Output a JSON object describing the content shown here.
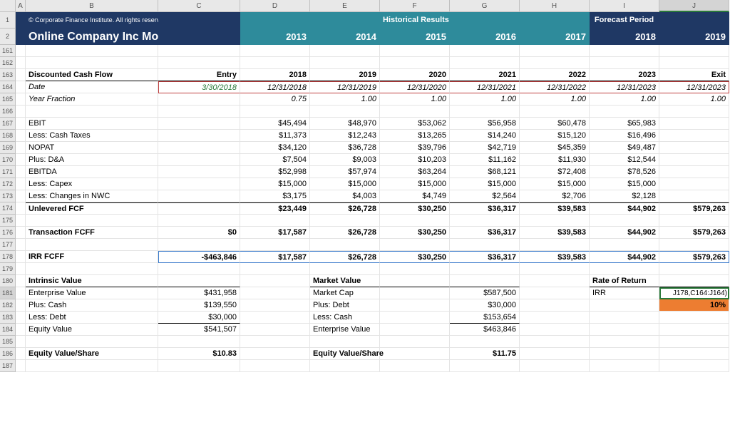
{
  "cols": [
    "A",
    "B",
    "C",
    "D",
    "E",
    "F",
    "G",
    "H",
    "I",
    "J"
  ],
  "rowNumbers": [
    "1",
    "2",
    "161",
    "162",
    "163",
    "164",
    "165",
    "166",
    "167",
    "168",
    "169",
    "170",
    "171",
    "172",
    "173",
    "174",
    "175",
    "176",
    "177",
    "178",
    "179",
    "180",
    "181",
    "182",
    "183",
    "184",
    "185",
    "186",
    "187"
  ],
  "header": {
    "copyright": "© Corporate Finance Institute. All rights reserved.",
    "historical": "Historical Results",
    "forecast": "Forecast Period",
    "title": "Online Company Inc Model",
    "years": [
      "2013",
      "2014",
      "2015",
      "2016",
      "2017",
      "2018",
      "2019"
    ]
  },
  "dcf": {
    "heading": "Discounted Cash Flow",
    "entry": "Entry",
    "periods": [
      "2018",
      "2019",
      "2020",
      "2021",
      "2022",
      "2023"
    ],
    "exit": "Exit",
    "dateLabel": "Date",
    "dateEntry": "3/30/2018",
    "dates": [
      "12/31/2018",
      "12/31/2019",
      "12/31/2020",
      "12/31/2021",
      "12/31/2022",
      "12/31/2023",
      "12/31/2023"
    ],
    "yfLabel": "Year Fraction",
    "yf": [
      "0.75",
      "1.00",
      "1.00",
      "1.00",
      "1.00",
      "1.00",
      "1.00"
    ],
    "rows": [
      {
        "label": "EBIT",
        "v": [
          "$45,494",
          "$48,970",
          "$53,062",
          "$56,958",
          "$60,478",
          "$65,983",
          ""
        ]
      },
      {
        "label": "Less: Cash Taxes",
        "v": [
          "$11,373",
          "$12,243",
          "$13,265",
          "$14,240",
          "$15,120",
          "$16,496",
          ""
        ],
        "ul": true
      },
      {
        "label": "NOPAT",
        "v": [
          "$34,120",
          "$36,728",
          "$39,796",
          "$42,719",
          "$45,359",
          "$49,487",
          ""
        ]
      },
      {
        "label": "Plus: D&A",
        "v": [
          "$7,504",
          "$9,003",
          "$10,203",
          "$11,162",
          "$11,930",
          "$12,544",
          ""
        ],
        "ul": true
      },
      {
        "label": "EBITDA",
        "v": [
          "$52,998",
          "$57,974",
          "$63,264",
          "$68,121",
          "$72,408",
          "$78,526",
          ""
        ]
      },
      {
        "label": "Less: Capex",
        "v": [
          "$15,000",
          "$15,000",
          "$15,000",
          "$15,000",
          "$15,000",
          "$15,000",
          ""
        ]
      },
      {
        "label": "Less: Changes in NWC",
        "v": [
          "$3,175",
          "$4,003",
          "$4,749",
          "$2,564",
          "$2,706",
          "$2,128",
          ""
        ],
        "ul": true
      }
    ],
    "ufcf": {
      "label": "Unlevered FCF",
      "v": [
        "$23,449",
        "$26,728",
        "$30,250",
        "$36,317",
        "$39,583",
        "$44,902",
        "$579,263"
      ]
    },
    "tfcff": {
      "label": "Transaction FCFF",
      "entry": "$0",
      "v": [
        "$17,587",
        "$26,728",
        "$30,250",
        "$36,317",
        "$39,583",
        "$44,902",
        "$579,263"
      ]
    },
    "irr": {
      "label": "IRR FCFF",
      "entry": "-$463,846",
      "v": [
        "$17,587",
        "$26,728",
        "$30,250",
        "$36,317",
        "$39,583",
        "$44,902",
        "$579,263"
      ]
    }
  },
  "intrinsic": {
    "heading": "Intrinsic Value",
    "rows": [
      {
        "label": "Enterprise Value",
        "val": "$431,958"
      },
      {
        "label": "Plus: Cash",
        "val": "$139,550"
      },
      {
        "label": "Less: Debt",
        "val": "$30,000",
        "ul": true
      },
      {
        "label": "Equity Value",
        "val": "$541,507"
      }
    ],
    "evps": {
      "label": "Equity Value/Share",
      "val": "$10.83"
    }
  },
  "market": {
    "heading": "Market Value",
    "rows": [
      {
        "label": "Market Cap",
        "val": "$587,500"
      },
      {
        "label": "Plus: Debt",
        "val": "$30,000"
      },
      {
        "label": "Less: Cash",
        "val": "$153,654",
        "ul": true
      },
      {
        "label": "Enterprise Value",
        "val": "$463,846"
      }
    ],
    "evps": {
      "label": "Equity Value/Share",
      "val": "$11.75"
    }
  },
  "ror": {
    "heading": "Rate of Return",
    "irrLabel": "IRR",
    "formula": "J178,C164:J164)",
    "pct": "10%"
  },
  "selectedRow": "181",
  "selectedCol": "J"
}
